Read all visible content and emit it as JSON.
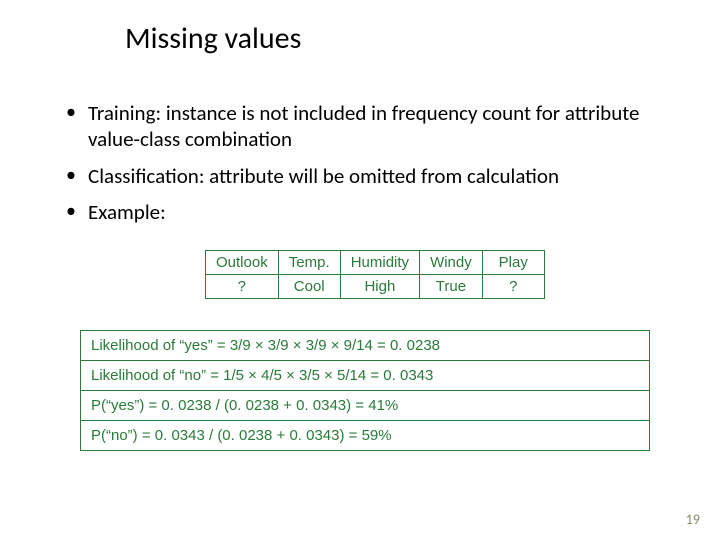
{
  "title": "Missing values",
  "bullets": [
    "Training: instance is not included in frequency count for attribute value-class combination",
    "Classification: attribute will be omitted from calculation",
    "Example:"
  ],
  "example_table": {
    "headers": [
      "Outlook",
      "Temp.",
      "Humidity",
      "Windy",
      "Play"
    ],
    "row": [
      "?",
      "Cool",
      "High",
      "True",
      "?"
    ]
  },
  "calculations": [
    "Likelihood of “yes” = 3/9 × 3/9 × 3/9 × 9/14 = 0. 0238",
    "Likelihood of “no” = 1/5 × 4/5 × 3/5 × 5/14 = 0. 0343",
    "P(“yes”) = 0. 0238 / (0. 0238 + 0. 0343) = 41%",
    "P(“no”) = 0. 0343 / (0. 0238 + 0. 0343) = 59%"
  ],
  "page_number": "19"
}
